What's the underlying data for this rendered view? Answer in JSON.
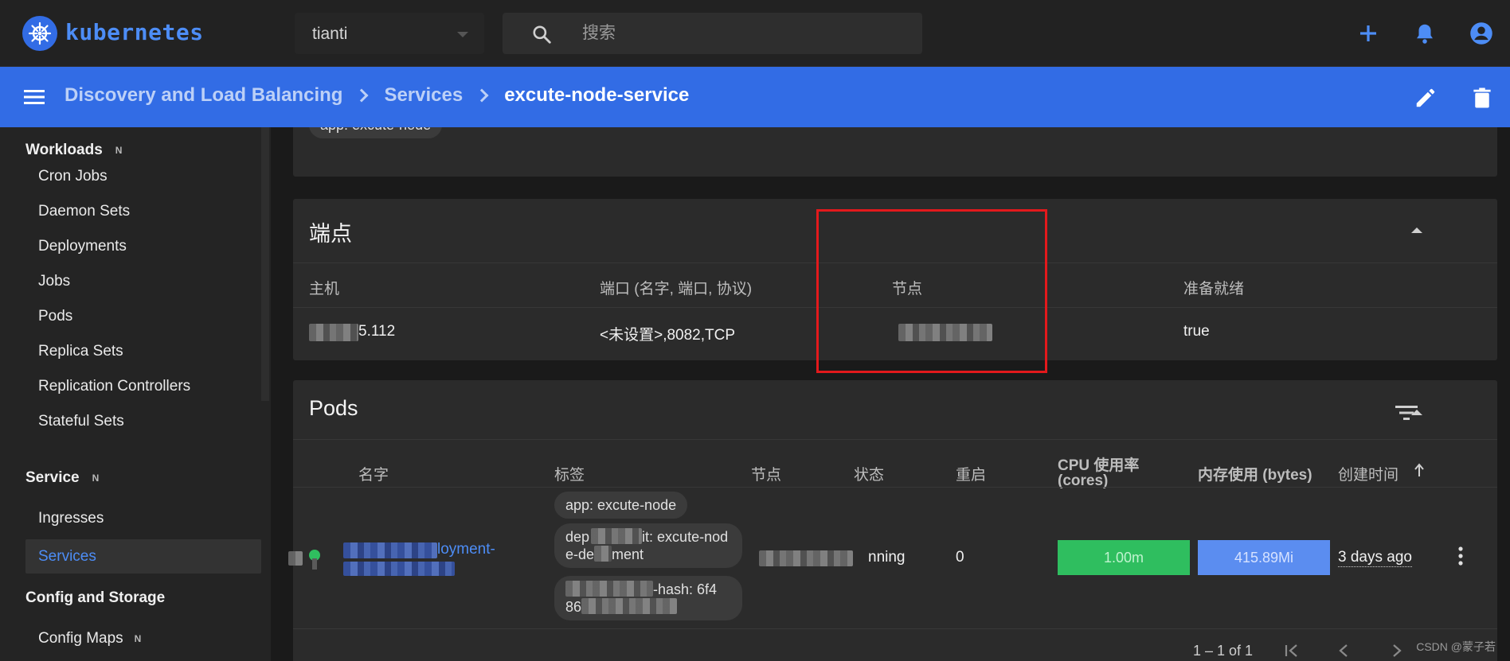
{
  "brand": {
    "name": "kubernetes"
  },
  "namespace": {
    "selected": "tianti"
  },
  "search": {
    "placeholder": "搜索"
  },
  "breadcrumb": {
    "items": [
      "Discovery and Load Balancing",
      "Services",
      "excute-node-service"
    ]
  },
  "sidebar": {
    "sections": [
      {
        "title": "Workloads",
        "badge": "N"
      },
      {
        "title": "Service",
        "badge": "N"
      },
      {
        "title": "Config and Storage",
        "badge": ""
      }
    ],
    "workload_items": [
      "Cron Jobs",
      "Daemon Sets",
      "Deployments",
      "Jobs",
      "Pods",
      "Replica Sets",
      "Replication Controllers",
      "Stateful Sets"
    ],
    "service_items": [
      "Ingresses",
      "Services"
    ],
    "config_items": [
      {
        "label": "Config Maps",
        "badge": "N"
      }
    ]
  },
  "selector_card": {
    "chip": "app: excute-node"
  },
  "endpoints": {
    "title": "端点",
    "headers": [
      "主机",
      "端口 (名字, 端口, 协议)",
      "节点",
      "准备就绪"
    ],
    "rows": [
      {
        "host_suffix": "5.112",
        "ports": "<未设置>,8082,TCP",
        "node": "",
        "ready": "true"
      }
    ]
  },
  "pods": {
    "title": "Pods",
    "headers": [
      "名字",
      "标签",
      "节点",
      "状态",
      "重启",
      "CPU 使用率",
      "(cores)",
      "内存使用 (bytes)",
      "创建时间"
    ],
    "row": {
      "name_visible": "loyment-",
      "labels": [
        "app: excute-node",
        "dep",
        "it: excute-nod",
        "e-de",
        "ment",
        "-hash: 6f4",
        "86"
      ],
      "status": "nning",
      "restarts": "0",
      "cpu": "1.00m",
      "memory": "415.89Mi",
      "created": "3 days ago"
    },
    "pagination": "1 – 1 of 1"
  },
  "watermark": "CSDN @蒙子若",
  "colors": {
    "accent": "#326ce5",
    "cpu_bar": "#2fbe5f",
    "memory_bar": "#5b8df0",
    "highlight_box": "#e3191c"
  }
}
